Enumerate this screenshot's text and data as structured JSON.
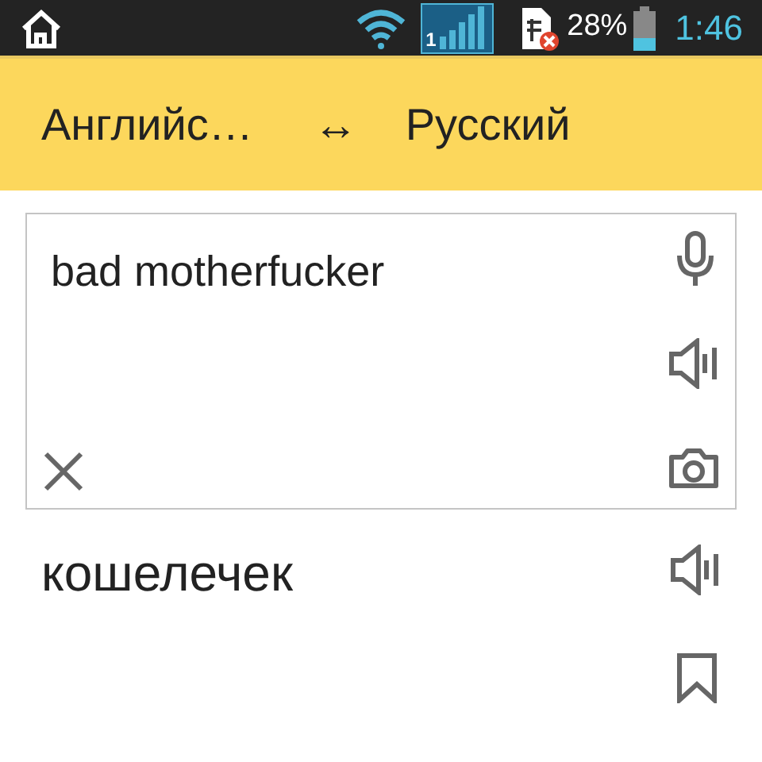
{
  "status_bar": {
    "sim_slot": "1",
    "battery": "28%",
    "time": "1:46"
  },
  "language_bar": {
    "source": "Английс…",
    "swap": "↔",
    "target": "Русский"
  },
  "input": {
    "value": "bad motherfucker"
  },
  "translation": {
    "text": "кошелечек"
  }
}
